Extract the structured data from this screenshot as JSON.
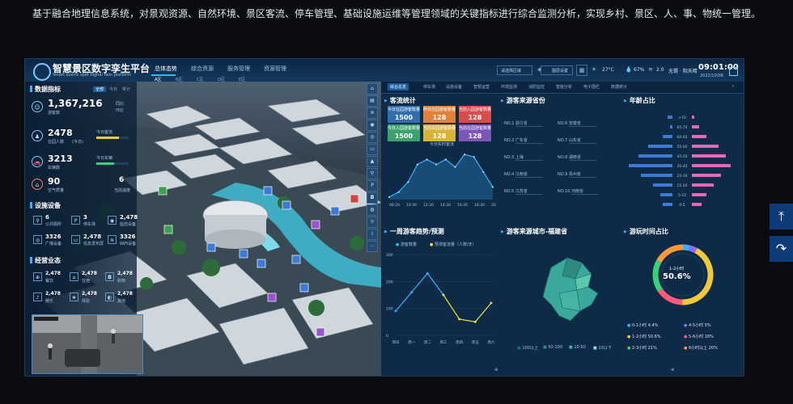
{
  "caption": "基于融合地理信息系统，对景观资源、自然环境、景区客流、停车管理、基础设施运维等管理领域的关键指标进行综合监测分析，实现乡村、景区、人、事、物统一管理。",
  "header": {
    "title": "智慧景区数字孪生平台",
    "subtitle": "Smart scenic spot digital twin platform",
    "nav": [
      {
        "label": "总体态势"
      },
      {
        "label": "综合资源"
      },
      {
        "label": "服务管理"
      },
      {
        "label": "资源管理"
      }
    ],
    "subtabs": [
      "A区",
      "B区",
      "C区",
      "D区",
      "E区"
    ],
    "select_label": "请选择区域",
    "config_label": "图层设置",
    "weather": {
      "temp": "27°C",
      "humidity": "67%",
      "wind": "2.0"
    },
    "location": "无锡 · 阴天晴",
    "time": "09:01:00",
    "date": "2022/10/08"
  },
  "left": {
    "data_title": "数据指标",
    "data_tabs": [
      "全部",
      "今日",
      "累计"
    ],
    "metrics": [
      {
        "value": "1,367,216",
        "label": "游客数",
        "sub1": "同比",
        "sub2": "环比"
      },
      {
        "value": "2478",
        "label": "在园人数",
        "side": "今日客流",
        "pct": "(今日)"
      },
      {
        "value": "3213",
        "label": "车辆数",
        "side": "今日车辆"
      },
      {
        "value": "90",
        "label": "空气质量",
        "side_value": "6",
        "side": "当前温度"
      }
    ],
    "facility_title": "设施设备",
    "facilities": [
      {
        "value": "6",
        "label": "公共厕所"
      },
      {
        "value": "3",
        "label": "停车场"
      },
      {
        "value": "2,478",
        "label": "监控设备"
      },
      {
        "value": "3326",
        "label": "广播设备"
      },
      {
        "value": "2,478",
        "label": "信息发布屏"
      },
      {
        "value": "3326",
        "label": "WiFi设备"
      }
    ],
    "business_title": "经营业态",
    "business": [
      {
        "value": "2,478",
        "label": "餐饮"
      },
      {
        "value": "2,478",
        "label": "住宿"
      },
      {
        "value": "2,478",
        "label": "购物"
      },
      {
        "value": "2,478",
        "label": "娱乐"
      },
      {
        "value": "2,478",
        "label": "体验"
      },
      {
        "value": "2,478",
        "label": "其他"
      }
    ]
  },
  "right": {
    "tabs": [
      "综合总览",
      "停车场",
      "设施设备",
      "智慧运营",
      "环境监测",
      "消防监控",
      "智能分析",
      "电子围栏",
      "数据统计"
    ],
    "flow_title": "客流统计",
    "flow_boxes": [
      {
        "label": "今日在园游客数量",
        "value": "1500",
        "color": "#2f6fb0"
      },
      {
        "label": "昨日在园游客数量",
        "value": "128",
        "color": "#e0823a"
      },
      {
        "label": "当前入园游客数量",
        "value": "128",
        "color": "#d94c4c"
      },
      {
        "label": "今日入园游客数量",
        "value": "1500",
        "color": "#3aa36d"
      },
      {
        "label": "当前出园游客数量",
        "value": "128",
        "color": "#d7b338"
      },
      {
        "label": "当前在园游客数量",
        "value": "128",
        "color": "#7b55b8"
      }
    ],
    "flow_chart_title": "今日实时客流",
    "origin_title": "游客来源省份",
    "origins": [
      {
        "rank": "NO.1",
        "name": "浙江省"
      },
      {
        "rank": "NO.6",
        "name": "安徽省"
      },
      {
        "rank": "NO.2",
        "name": "广东省"
      },
      {
        "rank": "NO.7",
        "name": "山东省"
      },
      {
        "rank": "NO.3",
        "name": "上海"
      },
      {
        "rank": "NO.8",
        "name": "湖南省"
      },
      {
        "rank": "NO.4",
        "name": "江西省"
      },
      {
        "rank": "NO.9",
        "name": "贵州省"
      },
      {
        "rank": "NO.5",
        "name": "江苏省"
      },
      {
        "rank": "NO.10",
        "name": "河南省"
      }
    ],
    "age_title": "年龄占比",
    "week_title": "一周游客趋势/预测",
    "week_legend": [
      "游客数量",
      "预测客流量（人数/天）"
    ],
    "city_title": "游客来源城市-福建省",
    "city_legend": [
      "100以上",
      "50-100",
      "10-50",
      "10以下"
    ],
    "stay_title": "游玩时间占比",
    "stay_center_label": "1-2小时",
    "stay_center_value": "50.6%",
    "stay_legend": [
      {
        "label": "0-1小时",
        "value": "4.4%",
        "color": "#36b4ff"
      },
      {
        "label": "4-5小时",
        "value": "5%",
        "color": "#8f6bff"
      },
      {
        "label": "1-2小时",
        "value": "50.6%",
        "color": "#f0c93a"
      },
      {
        "label": "5-6小时",
        "value": "18%",
        "color": "#ff5a7a"
      },
      {
        "label": "2-3小时",
        "value": "21%",
        "color": "#3ad07a"
      },
      {
        "label": "6小时以上",
        "value": "20%",
        "color": "#ff9a3a"
      }
    ]
  },
  "chart_data": [
    {
      "type": "area",
      "title": "今日实时客流",
      "x": [
        "08:20",
        "10:30",
        "12:30",
        "14:30",
        "16:30",
        "18:30",
        "20:30"
      ],
      "values": [
        1,
        3,
        7,
        14,
        16,
        14,
        16,
        13,
        18,
        17,
        11,
        5
      ]
    },
    {
      "type": "bar",
      "title": "年龄占比",
      "categories": [
        ">70",
        "65-70",
        "60-65",
        "55-60",
        "45-50",
        "35-40",
        "25-30",
        "15-20",
        "5-10",
        "0-5"
      ],
      "series": [
        {
          "name": "男",
          "values": [
            2,
            1,
            4,
            10,
            14,
            18,
            13,
            8,
            5,
            4
          ]
        },
        {
          "name": "女",
          "values": [
            1,
            3,
            6,
            11,
            14,
            16,
            12,
            9,
            6,
            4
          ]
        }
      ]
    },
    {
      "type": "line",
      "title": "一周游客趋势/预测",
      "x": [
        "周日",
        "周一",
        "周二",
        "周三",
        "周四",
        "周五",
        "周六"
      ],
      "series": [
        {
          "name": "游客数量",
          "values": [
            90,
            160,
            230,
            150
          ]
        },
        {
          "name": "预测客流量（人数/天）",
          "values": [
            null,
            null,
            null,
            150,
            60,
            50,
            120
          ]
        }
      ],
      "ylim": [
        0,
        300
      ]
    },
    {
      "type": "pie",
      "title": "游玩时间占比",
      "categories": [
        "0-1小时",
        "1-2小时",
        "2-3小时",
        "4-5小时",
        "5-6小时",
        "6小时以上"
      ],
      "values": [
        4.4,
        50.6,
        21,
        5,
        18,
        20
      ]
    }
  ]
}
